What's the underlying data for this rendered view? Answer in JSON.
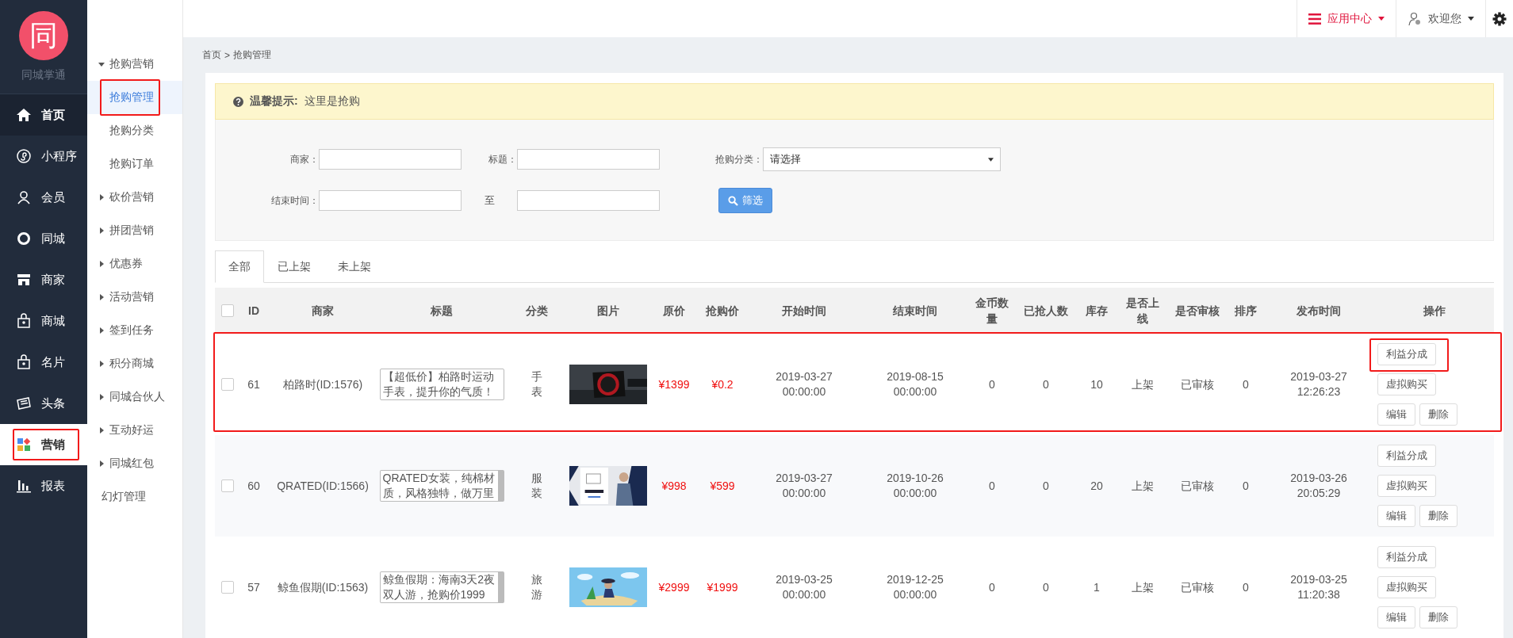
{
  "logo": {
    "mark": "同",
    "name": "同城掌通"
  },
  "nav": [
    {
      "label": "首页",
      "selected": false,
      "hover": true,
      "highlighted": false
    },
    {
      "label": "小程序",
      "selected": false,
      "hover": false,
      "highlighted": false
    },
    {
      "label": "会员",
      "selected": false,
      "hover": false,
      "highlighted": false
    },
    {
      "label": "同城",
      "selected": false,
      "hover": false,
      "highlighted": false
    },
    {
      "label": "商家",
      "selected": false,
      "hover": false,
      "highlighted": false
    },
    {
      "label": "商城",
      "selected": false,
      "hover": false,
      "highlighted": false
    },
    {
      "label": "名片",
      "selected": false,
      "hover": false,
      "highlighted": false
    },
    {
      "label": "头条",
      "selected": false,
      "hover": false,
      "highlighted": false
    },
    {
      "label": "营销",
      "selected": true,
      "hover": false,
      "highlighted": true
    },
    {
      "label": "报表",
      "selected": false,
      "hover": false,
      "highlighted": false
    }
  ],
  "submenu": [
    {
      "label": "抢购营销",
      "kind": "group",
      "expanded": true,
      "children": [
        {
          "label": "抢购管理",
          "kind": "item",
          "selected": true,
          "highlighted": true
        },
        {
          "label": "抢购分类",
          "kind": "item",
          "selected": false,
          "highlighted": false
        },
        {
          "label": "抢购订单",
          "kind": "item",
          "selected": false,
          "highlighted": false
        }
      ]
    },
    {
      "label": "砍价营销",
      "kind": "group",
      "expanded": false
    },
    {
      "label": "拼团营销",
      "kind": "group",
      "expanded": false
    },
    {
      "label": "优惠券",
      "kind": "group",
      "expanded": false
    },
    {
      "label": "活动营销",
      "kind": "group",
      "expanded": false
    },
    {
      "label": "签到任务",
      "kind": "group",
      "expanded": false
    },
    {
      "label": "积分商城",
      "kind": "group",
      "expanded": false
    },
    {
      "label": "同城合伙人",
      "kind": "group",
      "expanded": false
    },
    {
      "label": "互动好运",
      "kind": "group",
      "expanded": false
    },
    {
      "label": "同城红包",
      "kind": "group",
      "expanded": false
    },
    {
      "label": "幻灯管理",
      "kind": "item",
      "selected": false,
      "highlighted": false
    }
  ],
  "topbar": {
    "app_center": "应用中心",
    "welcome": "欢迎您"
  },
  "breadcrumb": {
    "home": "首页",
    "separator": ">",
    "current": "抢购管理"
  },
  "notice": {
    "title": "温馨提示:",
    "text": "这里是抢购"
  },
  "filters": {
    "merchant_label": "商家：",
    "title_label": "标题：",
    "category_label": "抢购分类：",
    "category_value": "请选择",
    "end_label": "结束时间：",
    "to_label": "至",
    "button": "筛选"
  },
  "tabs": [
    {
      "label": "全部",
      "selected": true
    },
    {
      "label": "已上架",
      "selected": false
    },
    {
      "label": "未上架",
      "selected": false
    }
  ],
  "table": {
    "all_checked": false,
    "columns": [
      "ID",
      "商家",
      "标题",
      "分类",
      "图片",
      "原价",
      "抢购价",
      "开始时间",
      "结束时间",
      "金币数量",
      "已抢人数",
      "库存",
      "是否上线",
      "是否审核",
      "排序",
      "发布时间",
      "操作"
    ],
    "rows": [
      {
        "id": "61",
        "merchant": "柏路时(ID:1576)",
        "title": "【超低价】柏路时运动手表，提升你的气质！",
        "category": "手表",
        "picture": {
          "kind": "picture"
        },
        "checked": false,
        "price": "¥1399",
        "sale_price": "¥0.2",
        "start": [
          "2019-03-27",
          "00:00:00"
        ],
        "end": [
          "2019-08-15",
          "00:00:00"
        ],
        "coins": "0",
        "grabbed": "0",
        "stock": "10",
        "online": "上架",
        "review": "已审核",
        "sort": "0",
        "published": [
          "2019-03-27",
          "12:26:23"
        ],
        "actions": [
          "利益分成",
          "虚拟购买",
          "编辑",
          "删除"
        ],
        "highlighted": true,
        "highlighted_action": true,
        "scrollbar": false
      },
      {
        "id": "60",
        "merchant": "QRATED(ID:1566)",
        "title": "QRATED女装，纯棉材质，风格独特，做万里",
        "category": "服装",
        "picture": {
          "kind": "picture"
        },
        "checked": false,
        "price": "¥998",
        "sale_price": "¥599",
        "start": [
          "2019-03-27",
          "00:00:00"
        ],
        "end": [
          "2019-10-26",
          "00:00:00"
        ],
        "coins": "0",
        "grabbed": "0",
        "stock": "20",
        "online": "上架",
        "review": "已审核",
        "sort": "0",
        "published": [
          "2019-03-26",
          "20:05:29"
        ],
        "actions": [
          "利益分成",
          "虚拟购买",
          "编辑",
          "删除"
        ],
        "highlighted": false,
        "highlighted_action": false,
        "scrollbar": true
      },
      {
        "id": "57",
        "merchant": "鲸鱼假期(ID:1563)",
        "title": "鲸鱼假期：海南3天2夜双人游，抢购价1999",
        "category": "旅游",
        "picture": {
          "kind": "picture"
        },
        "checked": false,
        "price": "¥2999",
        "sale_price": "¥1999",
        "start": [
          "2019-03-25",
          "00:00:00"
        ],
        "end": [
          "2019-12-25",
          "00:00:00"
        ],
        "coins": "0",
        "grabbed": "0",
        "stock": "1",
        "online": "上架",
        "review": "已审核",
        "sort": "0",
        "published": [
          "2019-03-25",
          "11:20:38"
        ],
        "actions": [
          "利益分成",
          "虚拟购买",
          "编辑",
          "删除"
        ],
        "highlighted": false,
        "highlighted_action": false,
        "scrollbar": true
      }
    ]
  }
}
